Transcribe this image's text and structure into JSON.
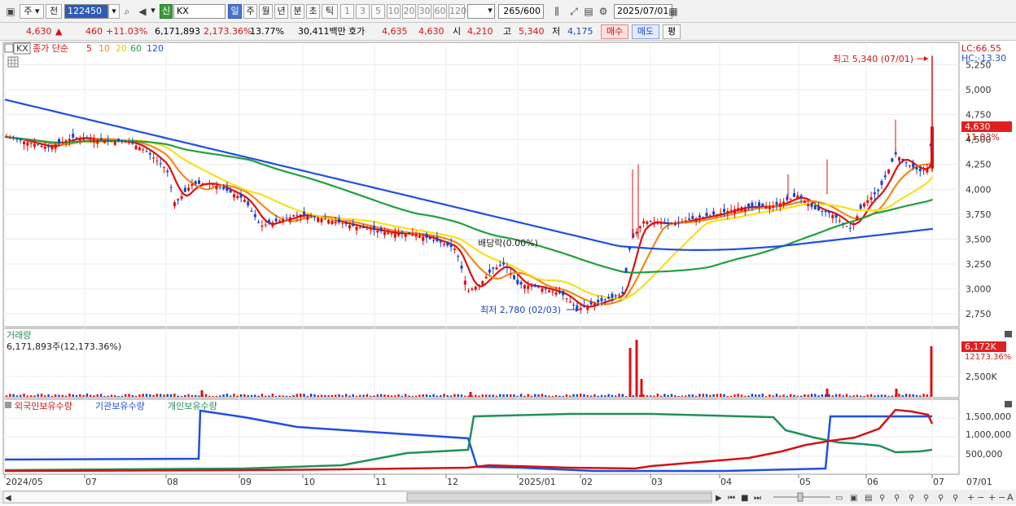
{
  "toolbar": {
    "period_select": "주",
    "prev_label": "전",
    "stock_code": "122450",
    "new_badge": "신",
    "stock_name": "KX",
    "timeframes": [
      "일",
      "주",
      "월",
      "년",
      "분",
      "초",
      "틱"
    ],
    "minute_units": [
      "1",
      "3",
      "5",
      "10",
      "20",
      "30",
      "60",
      "120"
    ],
    "count_value": "265",
    "count_max": "/600",
    "date_value": "2025/07/01"
  },
  "quote": {
    "price": "4,630",
    "change_arrow": "▲",
    "change": "460",
    "change_pct": "+11.03%",
    "volume": "6,171,893",
    "volume_pct": "2,173.36%",
    "turnover": "13.77%",
    "amount": "30,411백만",
    "ask_label": "호가",
    "ask_price": "4,635",
    "bid_price": "4,630",
    "open_label": "시",
    "open": "4,210",
    "high_label": "고",
    "high": "5,340",
    "low_label": "저",
    "low": "4,175",
    "buy_label": "매수",
    "sell_label": "매도",
    "eval_label": "평"
  },
  "price_pane": {
    "legend_name": "KX",
    "legend_type": "종가 단순",
    "ma_periods": [
      "5",
      "10",
      "20",
      "60",
      "120"
    ],
    "ma_colors": [
      "#e01010",
      "#f08a1a",
      "#f5e020",
      "#20a040",
      "#2050e0"
    ],
    "lc_label": "LC:66.55",
    "hc_label": "HC:-13.30",
    "y_ticks": [
      "5,250",
      "5,000",
      "4,750",
      "4,500",
      "4,250",
      "4,000",
      "3,750",
      "3,500",
      "3,250",
      "3,000",
      "2,750"
    ],
    "last_price_tag": "4,630",
    "last_pct_tag": "11.03%",
    "annot_high": "최고 5,340 (07/01)",
    "annot_low": "최저 2,780 (02/03)",
    "annot_dividend": "배당락(0.00%)"
  },
  "volume_pane": {
    "title": "거래량",
    "value_text": "6,171,893주(12,173.36%)",
    "tag_value": "6,172K",
    "tag_pct": "12173.36%",
    "y_tick": "2,500K"
  },
  "holdings_pane": {
    "legend": [
      "외국인보유수량",
      "기관보유수량",
      "개인보유수량"
    ],
    "legend_colors": [
      "#d21414",
      "#2050e0",
      "#20905a"
    ],
    "y_ticks": [
      "1,500,000",
      "1,000,000",
      "500,000"
    ]
  },
  "x_axis": {
    "labels": [
      "2024/05",
      "07",
      "08",
      "09",
      "10",
      "11",
      "12",
      "2025/01",
      "02",
      "03",
      "04",
      "05",
      "06",
      "07"
    ],
    "right_label": "07/01"
  },
  "chart_data": {
    "type": "candlestick",
    "y_range": [
      2650,
      5380
    ],
    "moving_averages": [
      "5",
      "10",
      "20",
      "60",
      "120"
    ],
    "high": {
      "value": 5340,
      "date": "07/01"
    },
    "low": {
      "value": 2780,
      "date": "02/03"
    },
    "last": {
      "value": 4630,
      "change_pct": 11.03
    }
  }
}
